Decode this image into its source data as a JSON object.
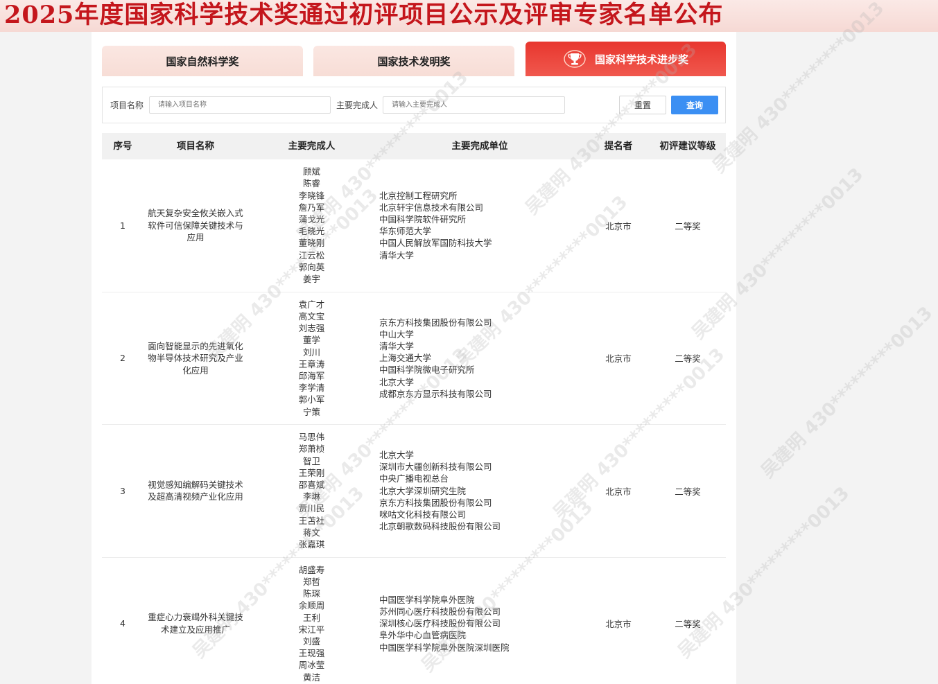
{
  "banner": {
    "title": "2025年度国家科学技术奖通过初评项目公示及评审专家名单公布"
  },
  "tabs": [
    {
      "label": "国家自然科学奖"
    },
    {
      "label": "国家技术发明奖"
    },
    {
      "label": "国家科学技术进步奖",
      "icon": "trophy-icon"
    }
  ],
  "search": {
    "project_label": "项目名称",
    "project_placeholder": "请输入项目名称",
    "person_label": "主要完成人",
    "person_placeholder": "请输入主要完成人",
    "reset_label": "重置",
    "query_label": "查询"
  },
  "table": {
    "headers": [
      "序号",
      "项目名称",
      "主要完成人",
      "主要完成单位",
      "提名者",
      "初评建议等级"
    ],
    "rows": [
      {
        "seq": "1",
        "name": "航天复杂安全攸关嵌入式软件可信保障关键技术与应用",
        "people": [
          "顾斌",
          "陈睿",
          "李晓锋",
          "詹乃军",
          "蒲戈光",
          "毛晓光",
          "董晓刚",
          "江云松",
          "郭向英",
          "姜宇"
        ],
        "units": [
          "北京控制工程研究所",
          "北京轩宇信息技术有限公司",
          "中国科学院软件研究所",
          "华东师范大学",
          "中国人民解放军国防科技大学",
          "清华大学"
        ],
        "nominator": "北京市",
        "grade": "二等奖"
      },
      {
        "seq": "2",
        "name": "面向智能显示的先进氧化物半导体技术研究及产业化应用",
        "people": [
          "袁广才",
          "高文宝",
          "刘志强",
          "董学",
          "刘川",
          "王章涛",
          "邱海军",
          "李学清",
          "郭小军",
          "宁策"
        ],
        "units": [
          "京东方科技集团股份有限公司",
          "中山大学",
          "清华大学",
          "上海交通大学",
          "中国科学院微电子研究所",
          "北京大学",
          "成都京东方显示科技有限公司"
        ],
        "nominator": "北京市",
        "grade": "二等奖"
      },
      {
        "seq": "3",
        "name": "视觉感知编解码关键技术及超高清视频产业化应用",
        "people": [
          "马思伟",
          "郑萧桢",
          "智卫",
          "王荣刚",
          "邵喜斌",
          "李琳",
          "贾川民",
          "王苫社",
          "蒋文",
          "张嘉琪"
        ],
        "units": [
          "北京大学",
          "深圳市大疆创新科技有限公司",
          "中央广播电视总台",
          "北京大学深圳研究生院",
          "京东方科技集团股份有限公司",
          "咪咕文化科技有限公司",
          "北京朝歌数码科技股份有限公司"
        ],
        "nominator": "北京市",
        "grade": "二等奖"
      },
      {
        "seq": "4",
        "name": "重症心力衰竭外科关键技术建立及应用推广",
        "people": [
          "胡盛寿",
          "郑哲",
          "陈琛",
          "余顺周",
          "王利",
          "宋江平",
          "刘盛",
          "王现强",
          "周冰莹",
          "黄洁"
        ],
        "units": [
          "中国医学科学院阜外医院",
          "苏州同心医疗科技股份有限公司",
          "深圳核心医疗科技股份有限公司",
          "阜外华中心血管病医院",
          "中国医学科学院阜外医院深圳医院"
        ],
        "nominator": "北京市",
        "grade": "二等奖"
      }
    ]
  },
  "watermark": {
    "name": "吴建明",
    "code": "430*********0013"
  }
}
